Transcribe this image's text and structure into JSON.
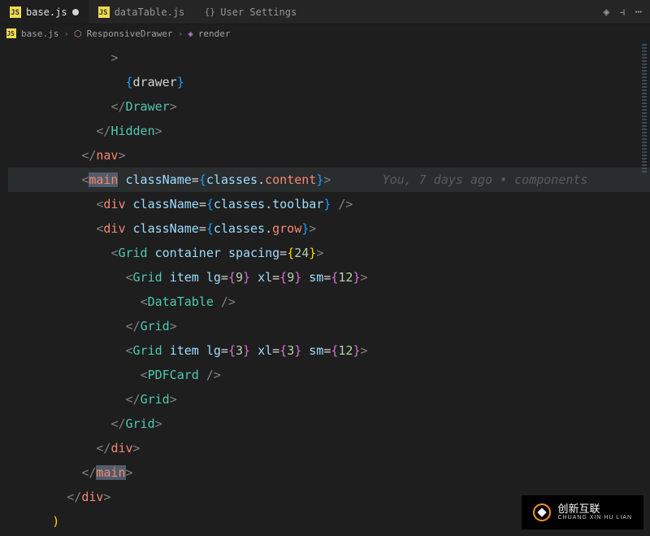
{
  "tabs": [
    {
      "label": "base.js",
      "icon": "js",
      "dirty": true,
      "active": true
    },
    {
      "label": "dataTable.js",
      "icon": "js",
      "dirty": false,
      "active": false
    },
    {
      "label": "User Settings",
      "icon": "json",
      "dirty": false,
      "active": false
    }
  ],
  "breadcrumb": {
    "file": "base.js",
    "symbol1": "ResponsiveDrawer",
    "symbol2": "render"
  },
  "blame": "You, 7 days ago • components",
  "code": {
    "l1": ">",
    "l2_open": "{",
    "l2_text": "drawer",
    "l2_close": "}",
    "l3_open": "</",
    "l3_tag": "Drawer",
    "l3_close": ">",
    "l4_open": "</",
    "l4_tag": "Hidden",
    "l4_close": ">",
    "l5_open": "</",
    "l5_tag": "nav",
    "l5_close": ">",
    "l6_open": "<",
    "l6_tag": "main",
    "l6_sp": " ",
    "l6_attr": "className",
    "l6_eq": "=",
    "l6_co": "{",
    "l6_obj": "classes",
    "l6_dot": ".",
    "l6_prop": "content",
    "l6_cc": "}",
    "l6_close": ">",
    "l7_open": "<",
    "l7_tag": "div",
    "l7_attr": "className",
    "l7_obj": "classes",
    "l7_prop": "toolbar",
    "l8_tag": "div",
    "l8_attr": "className",
    "l8_obj": "classes",
    "l8_prop": "grow",
    "l9_tag": "Grid",
    "l9_a1": "container",
    "l9_a2": "spacing",
    "l9_n": "24",
    "l10_tag": "Grid",
    "l10_a1": "item",
    "l10_lg": "lg",
    "l10_lgv": "9",
    "l10_xl": "xl",
    "l10_xlv": "9",
    "l10_sm": "sm",
    "l10_smv": "12",
    "l11_tag": "DataTable",
    "l12_tag": "Grid",
    "l13_tag": "Grid",
    "l13_a1": "item",
    "l13_lg": "lg",
    "l13_lgv": "3",
    "l13_xl": "xl",
    "l13_xlv": "3",
    "l13_sm": "sm",
    "l13_smv": "12",
    "l14_tag": "PDFCard",
    "l15_tag": "Grid",
    "l16_tag": "Grid",
    "l17_tag": "div",
    "l18_tag": "main",
    "l19_tag": "div",
    "l20": ")"
  },
  "watermark": {
    "main": "创新互联",
    "sub": "CHUANG XIN HU LIAN"
  }
}
